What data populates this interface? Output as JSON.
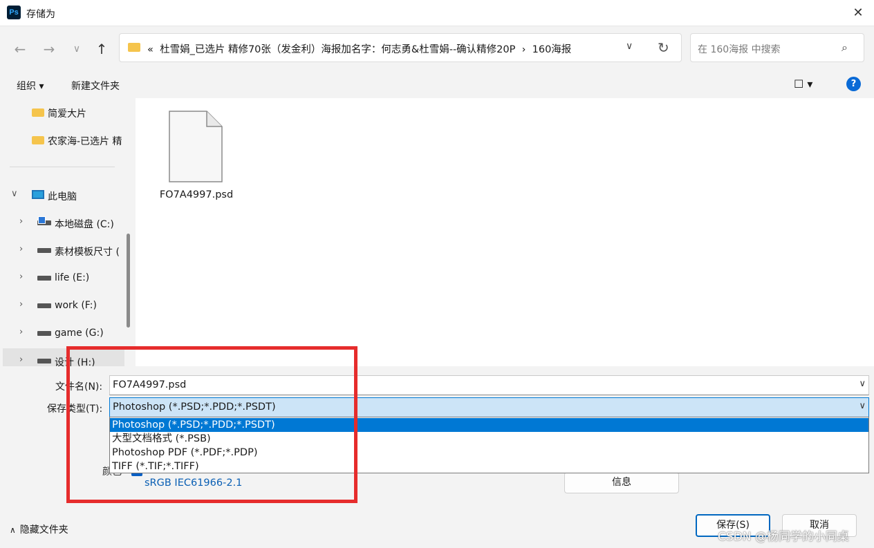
{
  "window": {
    "title": "存储为",
    "app_icon": "Ps"
  },
  "nav": {
    "breadcrumb_prefix": "«",
    "breadcrumb_path": "杜雪娟_已选片 精修70张（发金利）海报加名字：何志勇&杜雪娟--确认精修20P",
    "breadcrumb_sep": "›",
    "breadcrumb_current": "160海报",
    "search_placeholder": "在 160海报 中搜索"
  },
  "toolbar": {
    "organize": "组织 ▾",
    "new_folder": "新建文件夹",
    "help": "?"
  },
  "sidebar": {
    "folders": [
      "简爱大片",
      "农家海-已选片 精"
    ],
    "this_pc": "此电脑",
    "drives": [
      "本地磁盘 (C:)",
      "素材模板尺寸 (",
      "life (E:)",
      "work (F:)",
      "game (G:)",
      "设计 (H:)"
    ]
  },
  "files": [
    {
      "name": "FO7A4997.psd"
    }
  ],
  "form": {
    "filename_label": "文件名(N):",
    "filename_value": "FO7A4997.psd",
    "type_label": "保存类型(T):",
    "type_value": "Photoshop (*.PSD;*.PDD;*.PSDT)",
    "type_options": [
      "Photoshop (*.PSD;*.PDD;*.PSDT)",
      "大型文档格式 (*.PSB)",
      "Photoshop PDF (*.PDF;*.PDP)",
      "TIFF (*.TIF;*.TIFF)"
    ],
    "color_label": "颜色",
    "color_profile": "sRGB IEC61966-2.1",
    "info_button": "信息"
  },
  "footer": {
    "hide_folders": "隐藏文件夹",
    "save": "保存(S)",
    "cancel": "取消",
    "watermark": "CSDN @杨同学的小同桌"
  },
  "colors": {
    "accent": "#0078d4",
    "highlight_box": "#e62c2c",
    "folder": "#f5c44c"
  }
}
